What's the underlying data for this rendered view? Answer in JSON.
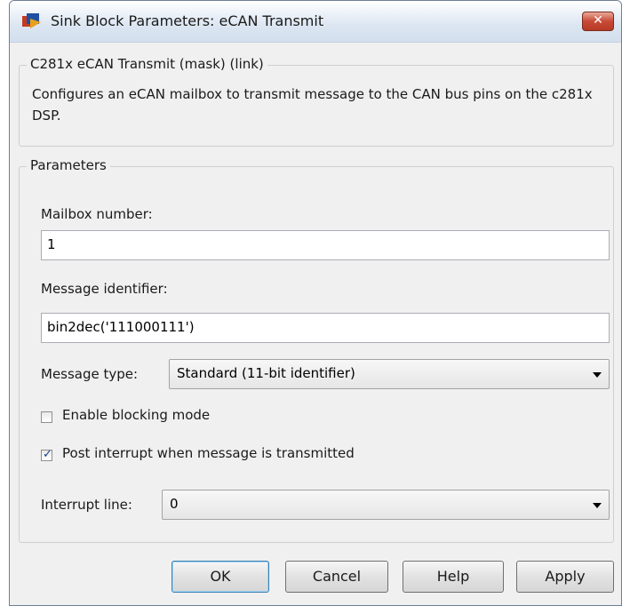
{
  "window": {
    "title": "Sink Block Parameters: eCAN Transmit",
    "close_glyph": "✕"
  },
  "mask": {
    "title": "C281x eCAN Transmit (mask) (link)",
    "description": "Configures an eCAN mailbox to transmit message to the CAN bus pins on the c281x DSP."
  },
  "parameters": {
    "title": "Parameters",
    "mailbox_label": "Mailbox number:",
    "mailbox_value": "1",
    "identifier_label": "Message identifier:",
    "identifier_value": "bin2dec('111000111')",
    "type_label": "Message type:",
    "type_value": "Standard (11-bit identifier)",
    "blocking_label": "Enable blocking mode",
    "blocking_checked": false,
    "interrupt_post_label": "Post interrupt when message is transmitted",
    "interrupt_post_checked": true,
    "checkmark_glyph": "✓",
    "interrupt_line_label": "Interrupt line:",
    "interrupt_line_value": "0"
  },
  "buttons": {
    "ok": "OK",
    "cancel": "Cancel",
    "help": "Help",
    "apply": "Apply"
  },
  "icons": {
    "app": "simulink-block-icon",
    "close": "close-icon"
  }
}
